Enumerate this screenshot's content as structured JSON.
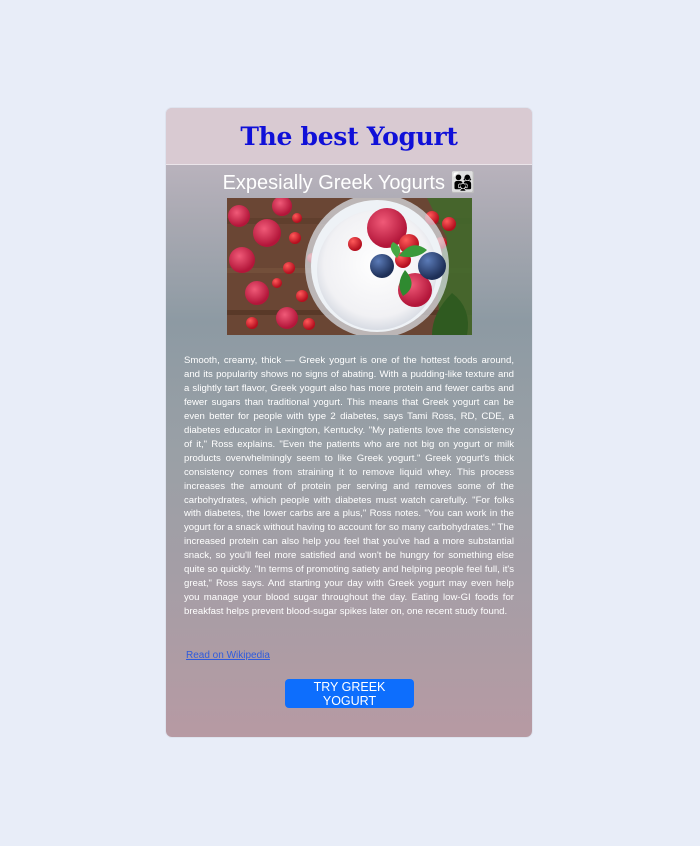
{
  "header": {
    "title": "The best Yogurt"
  },
  "subtitle": {
    "text": "Expesially Greek Yogurts",
    "emoji": "👨‍👩‍👧"
  },
  "image": {
    "alt": "bowl of greek yogurt with raspberries and blueberries"
  },
  "article": {
    "body": "Smooth, creamy, thick — Greek yogurt is one of the hottest foods around, and its popularity shows no signs of abating. With a pudding-like texture and a slightly tart flavor, Greek yogurt also has more protein and fewer carbs and fewer sugars than traditional yogurt. This means that Greek yogurt can be even better for people with type 2 diabetes, says Tami Ross, RD, CDE, a diabetes educator in Lexington, Kentucky. \"My patients love the consistency of it,\" Ross explains. \"Even the patients who are not big on yogurt or milk products overwhelmingly seem to like Greek yogurt.\" Greek yogurt's thick consistency comes from straining it to remove liquid whey. This process increases the amount of protein per serving and removes some of the carbohydrates, which people with diabetes must watch carefully. \"For folks with diabetes, the lower carbs are a plus,\" Ross notes. \"You can work in the yogurt for a snack without having to account for so many carbohydrates.\" The increased protein can also help you feel that you've had a more substantial snack, so you'll feel more satisfied and won't be hungry for something else quite so quickly. \"In terms of promoting satiety and helping people feel full, it's great,\" Ross says. And starting your day with Greek yogurt may even help you manage your blood sugar throughout the day. Eating low-GI foods for breakfast helps prevent blood-sugar spikes later on, one recent study found.",
    "link_label": "Read on Wikipedia"
  },
  "cta": {
    "label": "TRY GREEK YOGURT"
  },
  "colors": {
    "page_background": "#e8edf8",
    "title": "#1010d8",
    "link": "#2f5bdc",
    "button": "#0d6efd"
  }
}
